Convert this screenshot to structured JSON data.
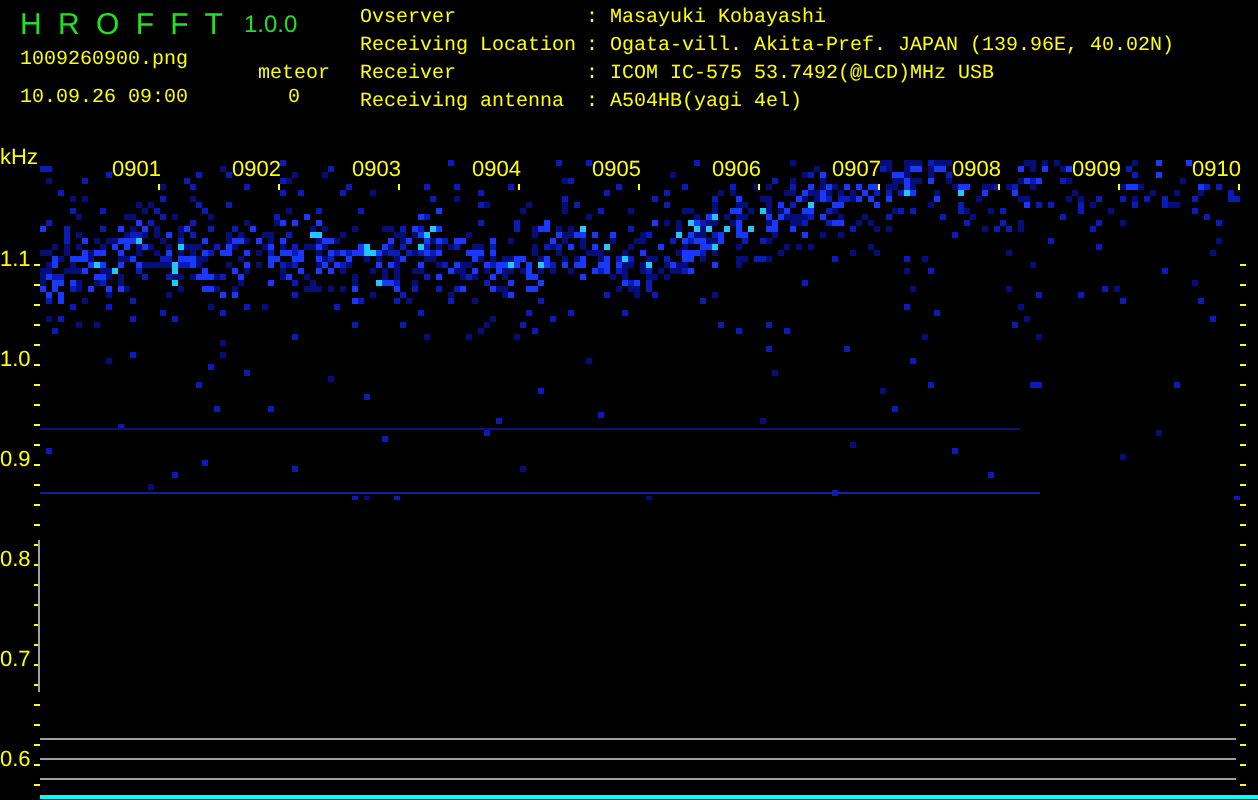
{
  "app": {
    "title": "H R O F F T",
    "version": "1.0.0",
    "file": "1009260900.png",
    "timestamp": "10.09.26 09:00",
    "counter_label": "meteor",
    "counter_value": "0"
  },
  "info": [
    {
      "label": "Ovserver",
      "separator": ":",
      "value": "Masayuki Kobayashi"
    },
    {
      "label": "Receiving Location",
      "separator": ":",
      "value": "Ogata-vill. Akita-Pref. JAPAN (139.96E, 40.02N)"
    },
    {
      "label": "Receiver",
      "separator": ":",
      "value": "ICOM IC-575 53.7492(@LCD)MHz USB"
    },
    {
      "label": "Receiving antenna",
      "separator": ":",
      "value": "A504HB(yagi 4el)"
    }
  ],
  "spectrogram": {
    "y_unit": "kHz",
    "y_labels": [
      "1.1",
      "1.0",
      "0.9",
      "0.8",
      "0.7",
      "0.6"
    ],
    "time_labels": [
      "0901",
      "0902",
      "0903",
      "0904",
      "0905",
      "0906",
      "0907",
      "0908",
      "0909",
      "0910"
    ]
  }
}
